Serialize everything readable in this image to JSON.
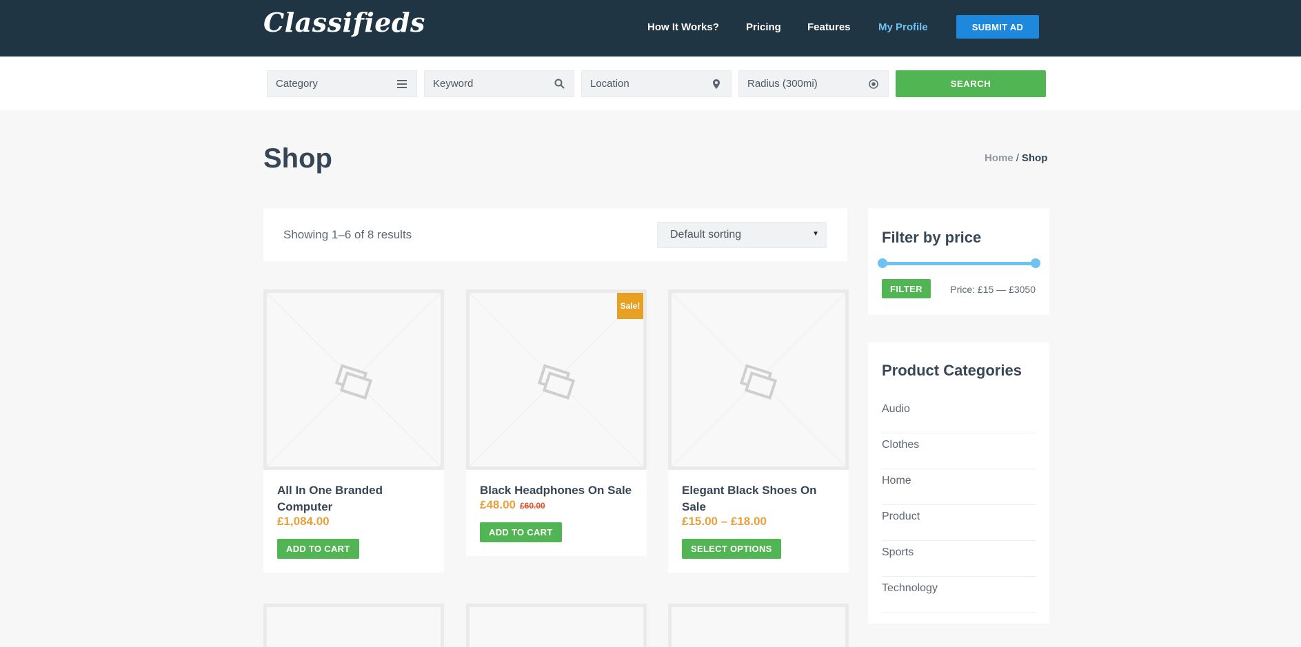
{
  "header": {
    "logo": "Classifieds",
    "nav": [
      {
        "label": "How It Works?",
        "active": false
      },
      {
        "label": "Pricing",
        "active": false
      },
      {
        "label": "Features",
        "active": false
      },
      {
        "label": "My Profile",
        "active": true
      }
    ],
    "submit_label": "SUBMIT AD"
  },
  "search": {
    "category": {
      "label": "Category",
      "icon": "menu-icon"
    },
    "keyword": {
      "label": "Keyword",
      "icon": "search-icon"
    },
    "location": {
      "label": "Location",
      "icon": "map-pin-icon"
    },
    "radius": {
      "label": "Radius (300mi)",
      "icon": "target-icon"
    },
    "button_label": "SEARCH"
  },
  "page": {
    "title": "Shop",
    "breadcrumb": {
      "home": "Home",
      "separator": "/",
      "current": "Shop"
    }
  },
  "results": {
    "count_text": "Showing 1–6 of 8 results",
    "sort_selected": "Default sorting"
  },
  "products": [
    {
      "title": "All In One Branded Computer",
      "price": "£1,084.00",
      "old_price": "",
      "on_sale": false,
      "cta": "ADD TO CART"
    },
    {
      "title": "Black Headphones On Sale",
      "price": "£48.00",
      "old_price": "£60.00",
      "on_sale": true,
      "sale_label": "Sale!",
      "cta": "ADD TO CART"
    },
    {
      "title": "Elegant Black Shoes On Sale",
      "price": "£15.00 – £18.00",
      "old_price": "",
      "on_sale": false,
      "cta": "SELECT OPTIONS"
    }
  ],
  "sidebar": {
    "price_filter": {
      "title": "Filter by price",
      "button_label": "FILTER",
      "range_text": "Price: £15 — £3050",
      "min_value": 15,
      "max_value": 3050
    },
    "categories": {
      "title": "Product Categories",
      "items": [
        "Audio",
        "Clothes",
        "Home",
        "Product",
        "Sports",
        "Technology"
      ]
    }
  },
  "colors": {
    "header_bg": "#203544",
    "accent_blue": "#1e88dc",
    "active_link": "#6ec2f0",
    "green": "#52b553",
    "price_orange": "#e8a03b",
    "sale_badge": "#e8a023",
    "page_bg": "#f7f7f7"
  }
}
